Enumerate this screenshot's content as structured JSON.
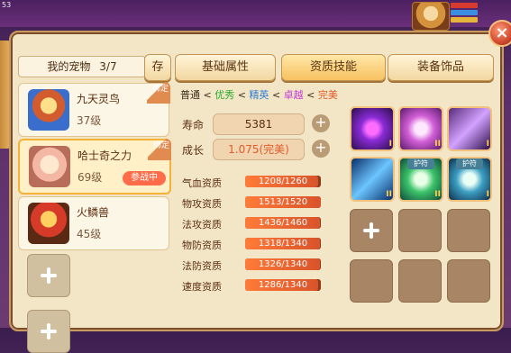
{
  "status": {
    "time": "53"
  },
  "header": {
    "pet_label": "我的宠物",
    "pet_count": "3/7",
    "store_button": "存"
  },
  "tabs": [
    {
      "label": "基础属性"
    },
    {
      "label": "资质技能"
    },
    {
      "label": "装备饰品"
    }
  ],
  "pets": [
    {
      "name": "九天灵鸟",
      "level": "37级",
      "tag": "绑定"
    },
    {
      "name": "哈士奇之力",
      "level": "69级",
      "tag": "绑定",
      "status": "参战中"
    },
    {
      "name": "火鳞兽",
      "level": "45级"
    }
  ],
  "quality": {
    "normal": "普通",
    "excellent": "优秀",
    "elite": "精英",
    "superior": "卓越",
    "perfect": "完美"
  },
  "stats": {
    "life_label": "寿命",
    "life_value": "5381",
    "growth_label": "成长",
    "growth_value": "1.075(完美)"
  },
  "aptitudes": [
    {
      "label": "气血资质",
      "value": "1208/1260",
      "fraction": 0.9587
    },
    {
      "label": "物攻资质",
      "value": "1513/1520",
      "fraction": 0.9954
    },
    {
      "label": "法攻资质",
      "value": "1436/1460",
      "fraction": 0.9836
    },
    {
      "label": "物防资质",
      "value": "1318/1340",
      "fraction": 0.9836
    },
    {
      "label": "法防资质",
      "value": "1326/1340",
      "fraction": 0.9896
    },
    {
      "label": "速度资质",
      "value": "1286/1340",
      "fraction": 0.9597
    }
  ],
  "skills": {
    "guard_label": "护符"
  },
  "colors": {
    "excellent": "#2aaa2a",
    "elite": "#2a7bd6",
    "superior": "#c43ad6",
    "perfect": "#e05b2a"
  }
}
